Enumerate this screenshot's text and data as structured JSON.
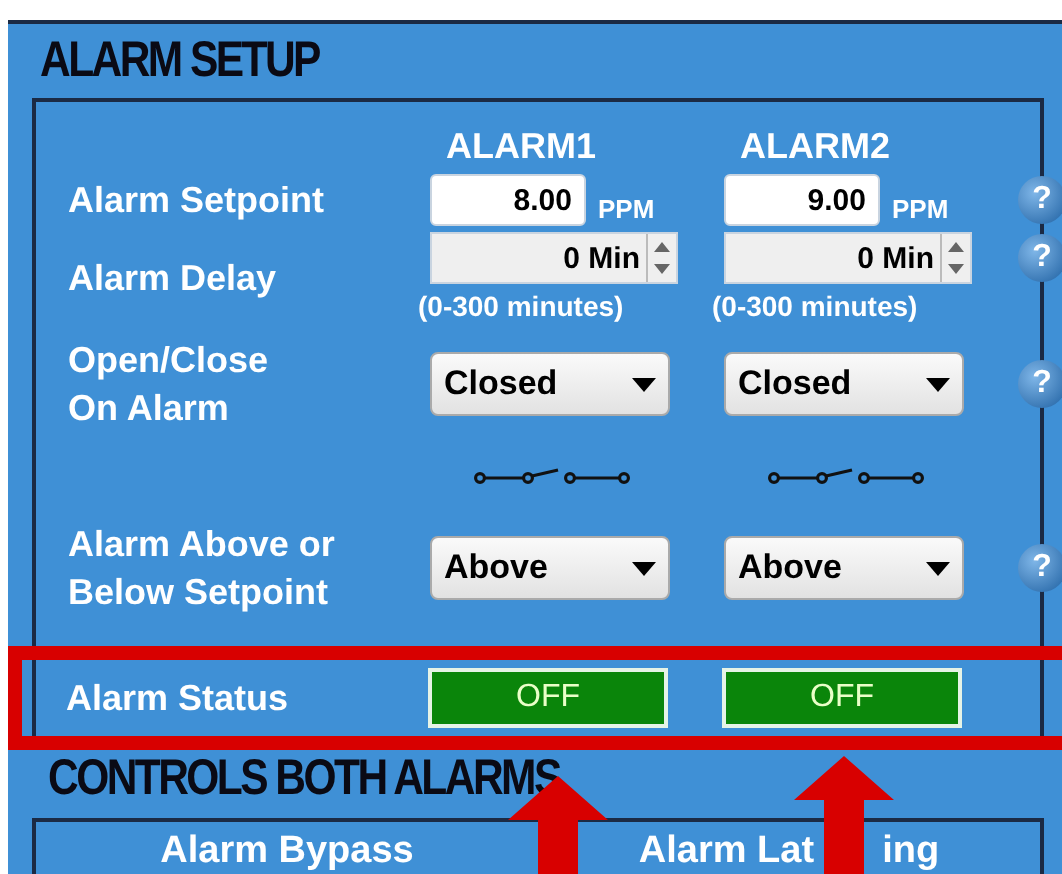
{
  "section_title": "ALARM SETUP",
  "columns": [
    "ALARM1",
    "ALARM2"
  ],
  "rows": [
    {
      "kind": "number",
      "label": "Alarm Setpoint",
      "values": [
        "8.00",
        "9.00"
      ],
      "units": [
        "PPM",
        "PPM"
      ],
      "help": "?"
    },
    {
      "kind": "spinner",
      "label": "Alarm Delay",
      "values": [
        "0 Min",
        "0 Min"
      ],
      "hints": [
        "(0-300 minutes)",
        "(0-300 minutes)"
      ],
      "help": "?"
    },
    {
      "kind": "select",
      "label": "Open/Close\nOn Alarm",
      "values": [
        "Closed",
        "Closed"
      ],
      "help": "?"
    },
    {
      "kind": "switch_icon"
    },
    {
      "kind": "select",
      "label": "Alarm Above or\nBelow Setpoint",
      "values": [
        "Above",
        "Above"
      ],
      "help": "?"
    },
    {
      "kind": "status",
      "label": "Alarm Status",
      "highlighted": true,
      "values": [
        {
          "text": "OFF",
          "on": false
        },
        {
          "text": "OFF",
          "on": false
        }
      ]
    }
  ],
  "controls_title": "CONTROLS BOTH ALARMS",
  "controls_columns": [
    {
      "parts": [
        "Alarm Bypass"
      ]
    },
    {
      "parts": [
        "Alarm Lat",
        "ing"
      ]
    }
  ]
}
